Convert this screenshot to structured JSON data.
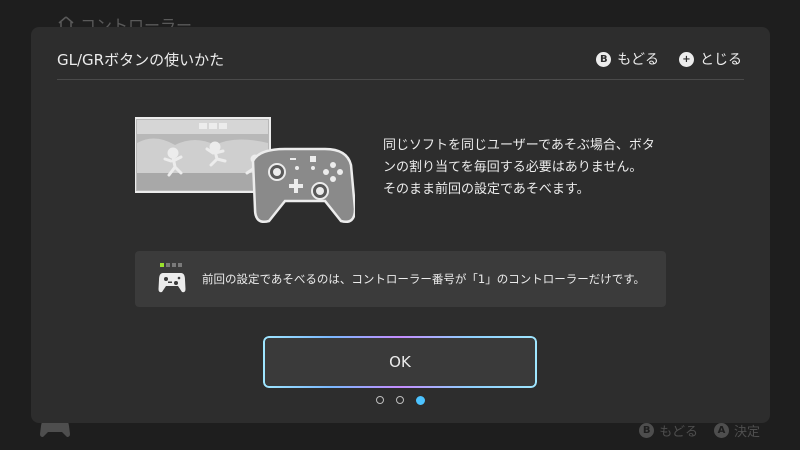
{
  "background": {
    "title": "コントローラー",
    "footer_hints": [
      {
        "key": "B",
        "label": "もどる"
      },
      {
        "key": "A",
        "label": "決定"
      }
    ]
  },
  "dialog": {
    "title": "GL/GRボタンの使いかた",
    "header_actions": [
      {
        "key": "B",
        "label": "もどる"
      },
      {
        "key": "+",
        "label": "とじる"
      }
    ],
    "description_lines": [
      "同じソフトを同じユーザーであそぶ場合、ボタ",
      "ンの割り当てを毎回する必要はありません。",
      "そのまま前回の設定であそべます。"
    ],
    "note": "前回の設定であそべるのは、コントローラー番号が「1」のコントローラーだけです。",
    "ok_label": "OK",
    "pager": {
      "total": 3,
      "current": 3
    }
  },
  "colors": {
    "accent_dot": "#4cc3ff",
    "player_led_active": "#9be22d",
    "dialog_bg": "#2d2d2d",
    "screen_bg": "#1e1e1e"
  }
}
